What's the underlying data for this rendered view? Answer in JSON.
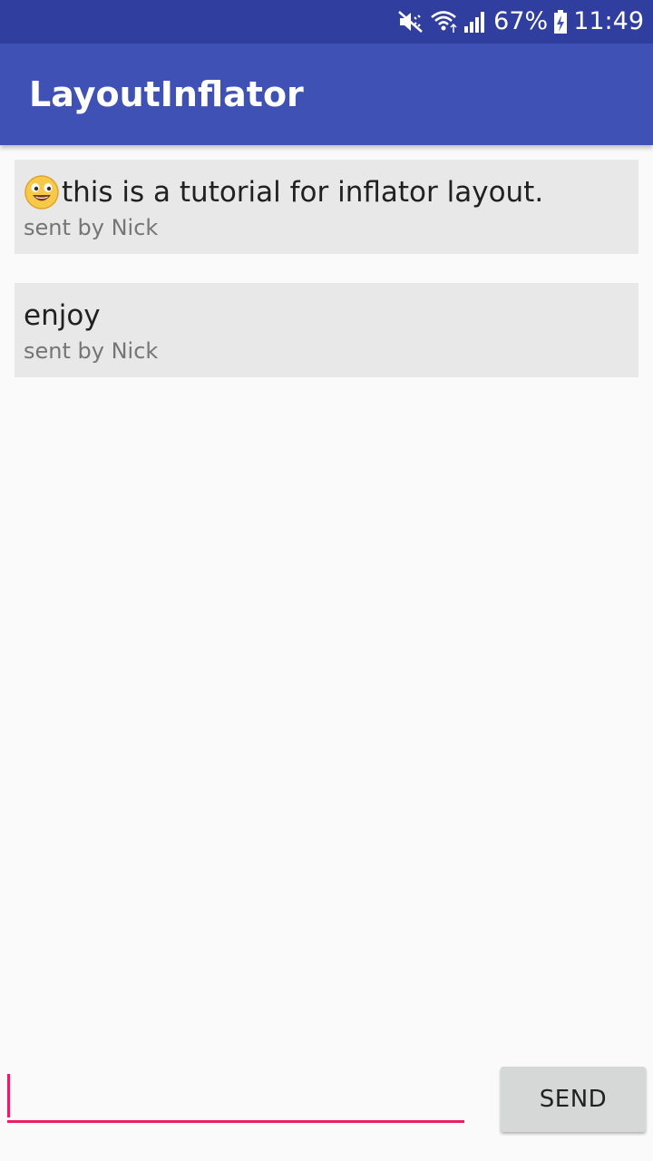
{
  "status_bar": {
    "battery_percent": "67%",
    "time": "11:49",
    "icons": [
      "mute-vibrate-icon",
      "wifi-icon",
      "signal-icon",
      "battery-charging-icon"
    ]
  },
  "app_bar": {
    "title": "LayoutInflator"
  },
  "messages": [
    {
      "emoji": "smiley-emoji-icon",
      "text": "this is a tutorial for inflator layout.",
      "sender": "sent by Nick"
    },
    {
      "text": "enjoy",
      "sender": "sent by Nick"
    }
  ],
  "compose": {
    "input_value": "",
    "send_label": "SEND"
  },
  "colors": {
    "status_bar": "#303f9f",
    "app_bar": "#3f51b5",
    "accent": "#e91e63",
    "card": "#e8e8e8",
    "button": "#d6d7d7"
  }
}
